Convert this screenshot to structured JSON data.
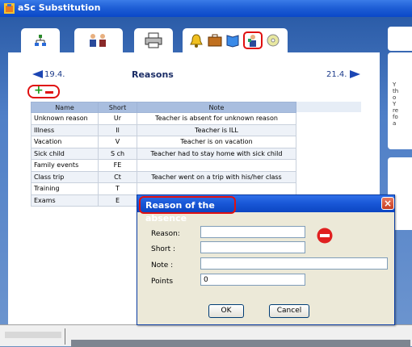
{
  "window": {
    "title": "aSc Substitution"
  },
  "toolbar": {
    "tabs": [
      {
        "icon": "tree-icon"
      },
      {
        "icon": "teachers-icon"
      },
      {
        "icon": "printer-icon"
      },
      {
        "icon": "warning-bell-icon"
      },
      {
        "icon": "suitcase-icon"
      },
      {
        "icon": "book-icon"
      },
      {
        "icon": "teacher-absence-icon"
      },
      {
        "icon": "cd-icon"
      }
    ]
  },
  "panel": {
    "heading": "Reasons",
    "prev_date": "19.4.",
    "next_date": "21.4.",
    "add_symbol": "+"
  },
  "table": {
    "columns": [
      "Name",
      "Short",
      "Note"
    ],
    "rows": [
      [
        "Unknown reason",
        "Ur",
        "Teacher is absent for unknown reason"
      ],
      [
        "Illness",
        "Il",
        "Teacher is ILL"
      ],
      [
        "Vacation",
        "V",
        "Teacher is on vacation"
      ],
      [
        "Sick child",
        "S ch",
        "Teacher had to stay home with sick child"
      ],
      [
        "Family events",
        "FE",
        ""
      ],
      [
        "Class trip",
        "Ct",
        "Teacher went on a trip with his/her class"
      ],
      [
        "Training",
        "T",
        ""
      ],
      [
        "Exams",
        "E",
        ""
      ]
    ]
  },
  "side_panel": {
    "text": "Y\nth\no\nY\nre\nfo\na"
  },
  "dialog": {
    "title": "Reason of the absence",
    "close_symbol": "×",
    "reason_label": "Reason:",
    "reason_value": "",
    "short_label": "Short :",
    "short_value": "",
    "note_label": "Note :",
    "note_value": "",
    "points_label": "Points",
    "points_value": "0",
    "ok_label": "OK",
    "cancel_label": "Cancel"
  },
  "colors": {
    "highlight": "#e01010",
    "titlebar": "#1f5fd6",
    "table_header": "#a9bedf",
    "add": "#1a9a1a"
  }
}
